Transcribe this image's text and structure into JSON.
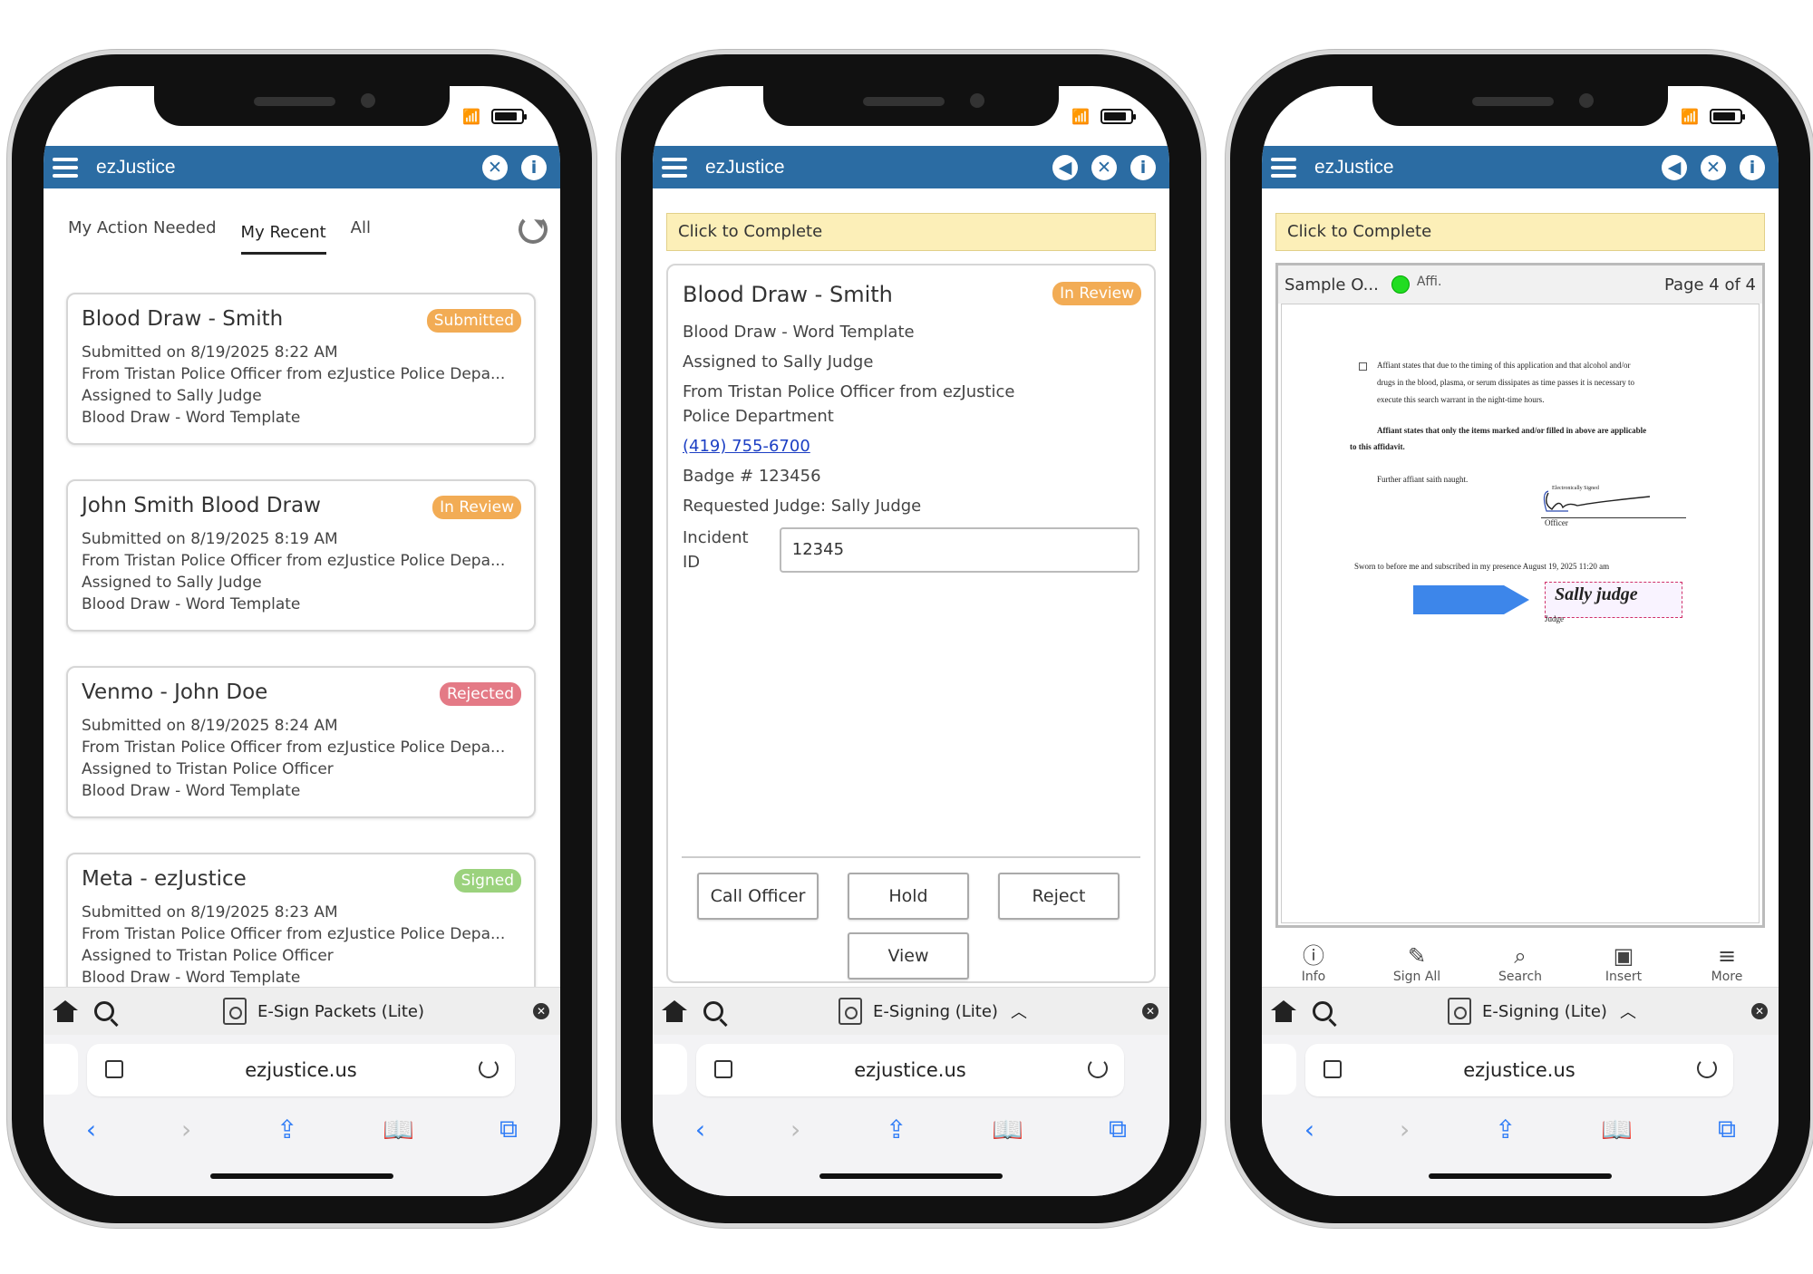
{
  "app_name": "ezJustice",
  "url": "ezjustice.us",
  "phone1": {
    "tabs": [
      "My Action Needed",
      "My Recent",
      "All"
    ],
    "bottom_title": "E-Sign Packets (Lite)",
    "cards": [
      {
        "title": "Blood Draw - Smith",
        "status": "Submitted",
        "status_color": "#f2ac55",
        "lines": [
          "Submitted on 8/19/2025 8:22 AM",
          "From Tristan Police Officer from ezJustice Police Depa...",
          "Assigned to Sally Judge",
          "Blood Draw - Word Template"
        ]
      },
      {
        "title": "John Smith Blood Draw",
        "status": "In Review",
        "status_color": "#f2ac55",
        "lines": [
          "Submitted on 8/19/2025 8:19 AM",
          "From Tristan Police Officer from ezJustice Police Depa...",
          "Assigned to Sally Judge",
          "Blood Draw - Word Template"
        ]
      },
      {
        "title": "Venmo - John Doe",
        "status": "Rejected",
        "status_color": "#e47a86",
        "lines": [
          "Submitted on 8/19/2025 8:24 AM",
          "From Tristan Police Officer from ezJustice Police Depa...",
          "Assigned to Tristan Police Officer",
          "Blood Draw - Word Template"
        ]
      },
      {
        "title": "Meta - ezJustice",
        "status": "Signed",
        "status_color": "#9bd27d",
        "lines": [
          "Submitted on 8/19/2025 8:23 AM",
          "From Tristan Police Officer from ezJustice Police Depa...",
          "Assigned to Tristan Police Officer",
          "Blood Draw - Word Template"
        ]
      }
    ]
  },
  "phone2": {
    "banner": "Click to Complete",
    "bottom_title": "E-Signing (Lite)",
    "title": "Blood Draw - Smith",
    "status": "In Review",
    "template": "Blood Draw - Word Template",
    "assigned": "Assigned to Sally Judge",
    "from": "From Tristan Police Officer from ezJustice Police Department",
    "phone": "(419) 755-6700",
    "badge": "Badge #  123456",
    "judge": "Requested Judge:  Sally Judge",
    "incident_label": "Incident ID",
    "incident_value": "12345",
    "buttons": {
      "call": "Call Officer",
      "hold": "Hold",
      "reject": "Reject",
      "view": "View"
    }
  },
  "phone3": {
    "banner": "Click to Complete",
    "bottom_title": "E-Signing (Lite)",
    "doc_name": "Sample O...",
    "doc_tag": "Affi.",
    "page_info": "Page 4 of 4",
    "doc": {
      "p1": "Affiant states that due to the timing of this application and that alcohol and/or",
      "p2": "drugs in the blood, plasma, or serum dissipates as time passes it is necessary to",
      "p3": "execute this search warrant in the night-time hours.",
      "p4": "Affiant states that only the items marked and/or filled in above are applicable",
      "p5": "to this affidavit.",
      "p6": "Further affiant saith naught.",
      "officer": "Officer",
      "sworn": "Sworn to before me and subscribed in my presence August 19, 2025 11:20 am",
      "judge": "Judge",
      "sig_judge": "Sally judge",
      "esig": "Electronically Signed"
    },
    "toolbar": [
      "Info",
      "Sign All",
      "Search",
      "Insert",
      "More"
    ]
  },
  "colors": {
    "appbar": "#2b6ca3",
    "banner": "#fcefb8",
    "link": "#1c3fc4",
    "arrow": "#3d86ea"
  }
}
